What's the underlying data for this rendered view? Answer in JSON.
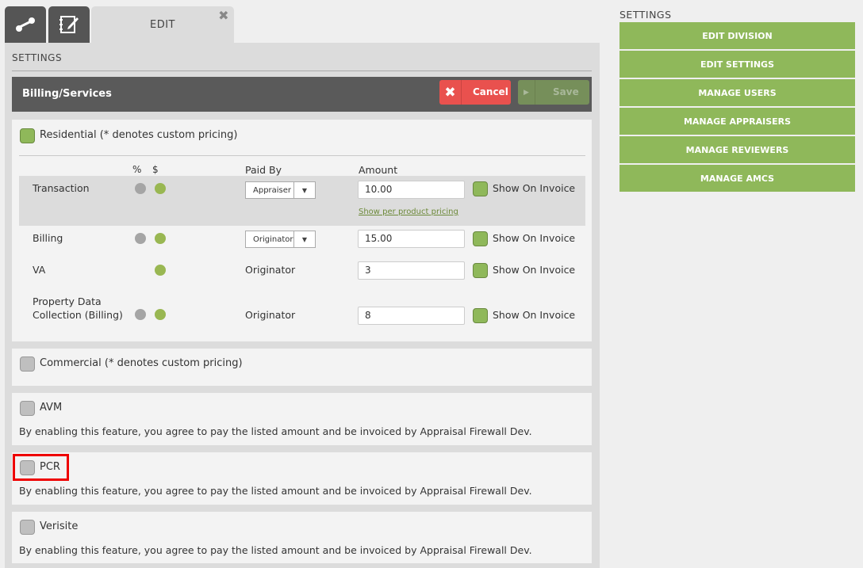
{
  "tabs": {
    "icons": [
      "route-icon",
      "edit-note-icon"
    ],
    "edit_label": "EDIT",
    "close_glyph": "✖"
  },
  "panel": {
    "settings_title": "SETTINGS",
    "billing_title": "Billing/Services",
    "cancel_label": "Cancel",
    "save_label": "Save"
  },
  "residential": {
    "label": "Residential (* denotes custom pricing)",
    "checked": true,
    "headers": {
      "pct": "%",
      "dollar": "$",
      "paid_by": "Paid By",
      "amount": "Amount"
    },
    "rows": [
      {
        "name": "Transaction",
        "paid_by": "Appraiser",
        "amount": "10.00",
        "show": "Show On Invoice",
        "link": "Show per product pricing"
      },
      {
        "name": "Billing",
        "paid_by": "Originator",
        "amount": "15.00",
        "show": "Show On Invoice"
      },
      {
        "name": "VA",
        "paid_by": "Originator",
        "amount": "3",
        "show": "Show On Invoice"
      },
      {
        "name_line1": "Property Data",
        "name_line2": "Collection (Billing)",
        "paid_by": "Originator",
        "amount": "8",
        "show": "Show On Invoice"
      }
    ]
  },
  "commercial": {
    "label": "Commercial (* denotes custom pricing)"
  },
  "avm": {
    "label": "AVM",
    "desc": "By enabling this feature, you agree to pay the listed amount and be invoiced by Appraisal Firewall Dev."
  },
  "pcr": {
    "label": "PCR",
    "desc": "By enabling this feature, you agree to pay the listed amount and be invoiced by Appraisal Firewall Dev."
  },
  "verisite": {
    "label": "Verisite",
    "desc": "By enabling this feature, you agree to pay the listed amount and be invoiced by Appraisal Firewall Dev."
  },
  "sidebar": {
    "title": "SETTINGS",
    "items": [
      "EDIT DIVISION",
      "EDIT SETTINGS",
      "MANAGE USERS",
      "MANAGE APPRAISERS",
      "MANAGE REVIEWERS",
      "MANAGE AMCS"
    ]
  },
  "colors": {
    "accent": "#8fb85a",
    "cancel": "#e9514e",
    "header_bar": "#5a5a5a",
    "highlight": "#ee0000"
  }
}
